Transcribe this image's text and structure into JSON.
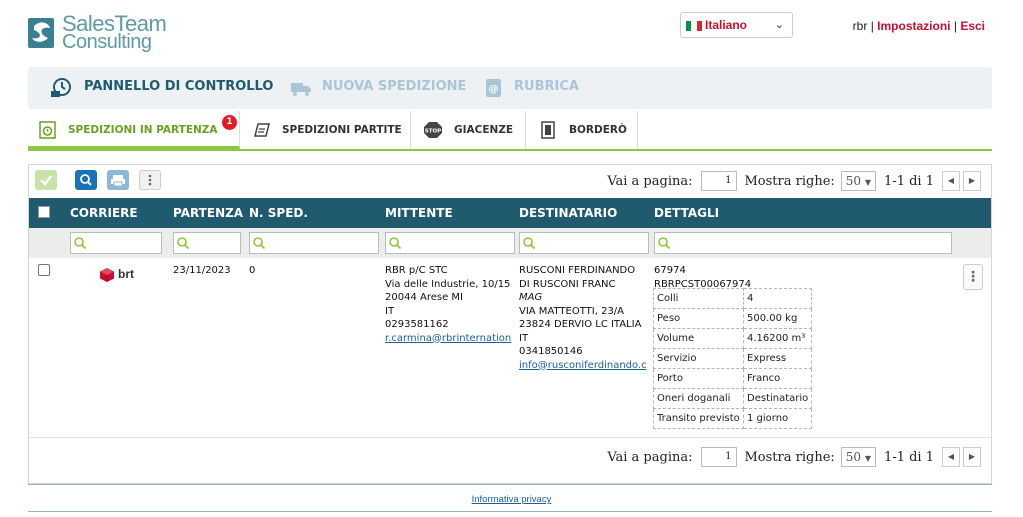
{
  "brand": {
    "logo_line1": "SalesTeam",
    "logo_line2": "Consulting"
  },
  "language": {
    "selected": "Italiano"
  },
  "user": {
    "name": "rbr",
    "settings_label": "Impostazioni",
    "logout_label": "Esci",
    "separator": "|"
  },
  "main_nav": [
    {
      "label": "PANNELLO DI CONTROLLO",
      "icon": "dashboard-clock-icon",
      "active": true
    },
    {
      "label": "NUOVA SPEDIZIONE",
      "icon": "truck-icon",
      "active": false
    },
    {
      "label": "RUBRICA",
      "icon": "address-book-icon",
      "active": false
    }
  ],
  "tabs": [
    {
      "label": "SPEDIZIONI IN PARTENZA",
      "badge": "1",
      "icon": "timer-icon",
      "active": true
    },
    {
      "label": "SPEDIZIONI PARTITE",
      "icon": "departed-truck-icon",
      "active": false
    },
    {
      "label": "GIACENZE",
      "icon": "stop-sign-icon",
      "active": false
    },
    {
      "label": "BORDERÒ",
      "icon": "document-icon",
      "active": false
    }
  ],
  "pager": {
    "goto_label": "Vai a pagina:",
    "page": "1",
    "rows_label": "Mostra righe:",
    "rows": "50",
    "range": "1-1 di 1"
  },
  "columns": [
    "CORRIERE",
    "PARTENZA",
    "N. SPED.",
    "MITTENTE",
    "DESTINATARIO",
    "DETTAGLI"
  ],
  "shipment": {
    "carrier": "brt",
    "departure": "23/11/2023",
    "number": "0",
    "sender": {
      "name": "RBR p/C STC",
      "street": "Via delle Industrie, 10/15",
      "city": "20044 Arese MI",
      "country": "IT",
      "phone": "0293581162",
      "email": "r.carmina@rbrinternation"
    },
    "recipient": {
      "name": "RUSCONI FERDINANDO",
      "name2": "DI RUSCONI FRANC",
      "note": "MAG",
      "street": "VIA MATTEOTTI, 23/A",
      "city": "23824 DERVIO LC ITALIA",
      "country": "IT",
      "phone": "0341850146",
      "email": "info@rusconiferdinando.c"
    },
    "details": {
      "code": "67974",
      "tracking": "RBRPCST00067974",
      "table": [
        {
          "key": "Colli",
          "value": "4"
        },
        {
          "key": "Peso",
          "value": "500.00 kg"
        },
        {
          "key": "Volume",
          "value": "4.16200 m³"
        },
        {
          "key": "Servizio",
          "value": "Express"
        },
        {
          "key": "Porto",
          "value": "Franco"
        },
        {
          "key": "Oneri doganali",
          "value": "Destinatario"
        },
        {
          "key": "Transito previsto",
          "value": "1 giorno"
        }
      ]
    }
  },
  "footer": {
    "privacy_label": "Informativa privacy"
  },
  "colors": {
    "accent_green": "#8dc63f",
    "header_blue": "#1f5a6e",
    "link_red": "#c8102e",
    "brt_red": "#c8102e"
  }
}
